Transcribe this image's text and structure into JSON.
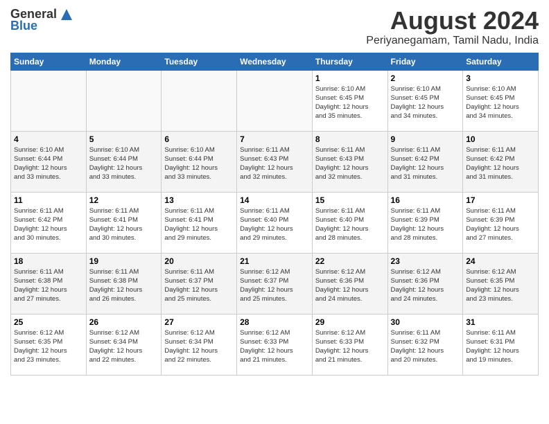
{
  "header": {
    "logo_general": "General",
    "logo_blue": "Blue",
    "month": "August 2024",
    "location": "Periyanegamam, Tamil Nadu, India"
  },
  "days_of_week": [
    "Sunday",
    "Monday",
    "Tuesday",
    "Wednesday",
    "Thursday",
    "Friday",
    "Saturday"
  ],
  "weeks": [
    [
      {
        "day": "",
        "info": ""
      },
      {
        "day": "",
        "info": ""
      },
      {
        "day": "",
        "info": ""
      },
      {
        "day": "",
        "info": ""
      },
      {
        "day": "1",
        "info": "Sunrise: 6:10 AM\nSunset: 6:45 PM\nDaylight: 12 hours\nand 35 minutes."
      },
      {
        "day": "2",
        "info": "Sunrise: 6:10 AM\nSunset: 6:45 PM\nDaylight: 12 hours\nand 34 minutes."
      },
      {
        "day": "3",
        "info": "Sunrise: 6:10 AM\nSunset: 6:45 PM\nDaylight: 12 hours\nand 34 minutes."
      }
    ],
    [
      {
        "day": "4",
        "info": "Sunrise: 6:10 AM\nSunset: 6:44 PM\nDaylight: 12 hours\nand 33 minutes."
      },
      {
        "day": "5",
        "info": "Sunrise: 6:10 AM\nSunset: 6:44 PM\nDaylight: 12 hours\nand 33 minutes."
      },
      {
        "day": "6",
        "info": "Sunrise: 6:10 AM\nSunset: 6:44 PM\nDaylight: 12 hours\nand 33 minutes."
      },
      {
        "day": "7",
        "info": "Sunrise: 6:11 AM\nSunset: 6:43 PM\nDaylight: 12 hours\nand 32 minutes."
      },
      {
        "day": "8",
        "info": "Sunrise: 6:11 AM\nSunset: 6:43 PM\nDaylight: 12 hours\nand 32 minutes."
      },
      {
        "day": "9",
        "info": "Sunrise: 6:11 AM\nSunset: 6:42 PM\nDaylight: 12 hours\nand 31 minutes."
      },
      {
        "day": "10",
        "info": "Sunrise: 6:11 AM\nSunset: 6:42 PM\nDaylight: 12 hours\nand 31 minutes."
      }
    ],
    [
      {
        "day": "11",
        "info": "Sunrise: 6:11 AM\nSunset: 6:42 PM\nDaylight: 12 hours\nand 30 minutes."
      },
      {
        "day": "12",
        "info": "Sunrise: 6:11 AM\nSunset: 6:41 PM\nDaylight: 12 hours\nand 30 minutes."
      },
      {
        "day": "13",
        "info": "Sunrise: 6:11 AM\nSunset: 6:41 PM\nDaylight: 12 hours\nand 29 minutes."
      },
      {
        "day": "14",
        "info": "Sunrise: 6:11 AM\nSunset: 6:40 PM\nDaylight: 12 hours\nand 29 minutes."
      },
      {
        "day": "15",
        "info": "Sunrise: 6:11 AM\nSunset: 6:40 PM\nDaylight: 12 hours\nand 28 minutes."
      },
      {
        "day": "16",
        "info": "Sunrise: 6:11 AM\nSunset: 6:39 PM\nDaylight: 12 hours\nand 28 minutes."
      },
      {
        "day": "17",
        "info": "Sunrise: 6:11 AM\nSunset: 6:39 PM\nDaylight: 12 hours\nand 27 minutes."
      }
    ],
    [
      {
        "day": "18",
        "info": "Sunrise: 6:11 AM\nSunset: 6:38 PM\nDaylight: 12 hours\nand 27 minutes."
      },
      {
        "day": "19",
        "info": "Sunrise: 6:11 AM\nSunset: 6:38 PM\nDaylight: 12 hours\nand 26 minutes."
      },
      {
        "day": "20",
        "info": "Sunrise: 6:11 AM\nSunset: 6:37 PM\nDaylight: 12 hours\nand 25 minutes."
      },
      {
        "day": "21",
        "info": "Sunrise: 6:12 AM\nSunset: 6:37 PM\nDaylight: 12 hours\nand 25 minutes."
      },
      {
        "day": "22",
        "info": "Sunrise: 6:12 AM\nSunset: 6:36 PM\nDaylight: 12 hours\nand 24 minutes."
      },
      {
        "day": "23",
        "info": "Sunrise: 6:12 AM\nSunset: 6:36 PM\nDaylight: 12 hours\nand 24 minutes."
      },
      {
        "day": "24",
        "info": "Sunrise: 6:12 AM\nSunset: 6:35 PM\nDaylight: 12 hours\nand 23 minutes."
      }
    ],
    [
      {
        "day": "25",
        "info": "Sunrise: 6:12 AM\nSunset: 6:35 PM\nDaylight: 12 hours\nand 23 minutes."
      },
      {
        "day": "26",
        "info": "Sunrise: 6:12 AM\nSunset: 6:34 PM\nDaylight: 12 hours\nand 22 minutes."
      },
      {
        "day": "27",
        "info": "Sunrise: 6:12 AM\nSunset: 6:34 PM\nDaylight: 12 hours\nand 22 minutes."
      },
      {
        "day": "28",
        "info": "Sunrise: 6:12 AM\nSunset: 6:33 PM\nDaylight: 12 hours\nand 21 minutes."
      },
      {
        "day": "29",
        "info": "Sunrise: 6:12 AM\nSunset: 6:33 PM\nDaylight: 12 hours\nand 21 minutes."
      },
      {
        "day": "30",
        "info": "Sunrise: 6:11 AM\nSunset: 6:32 PM\nDaylight: 12 hours\nand 20 minutes."
      },
      {
        "day": "31",
        "info": "Sunrise: 6:11 AM\nSunset: 6:31 PM\nDaylight: 12 hours\nand 19 minutes."
      }
    ]
  ]
}
